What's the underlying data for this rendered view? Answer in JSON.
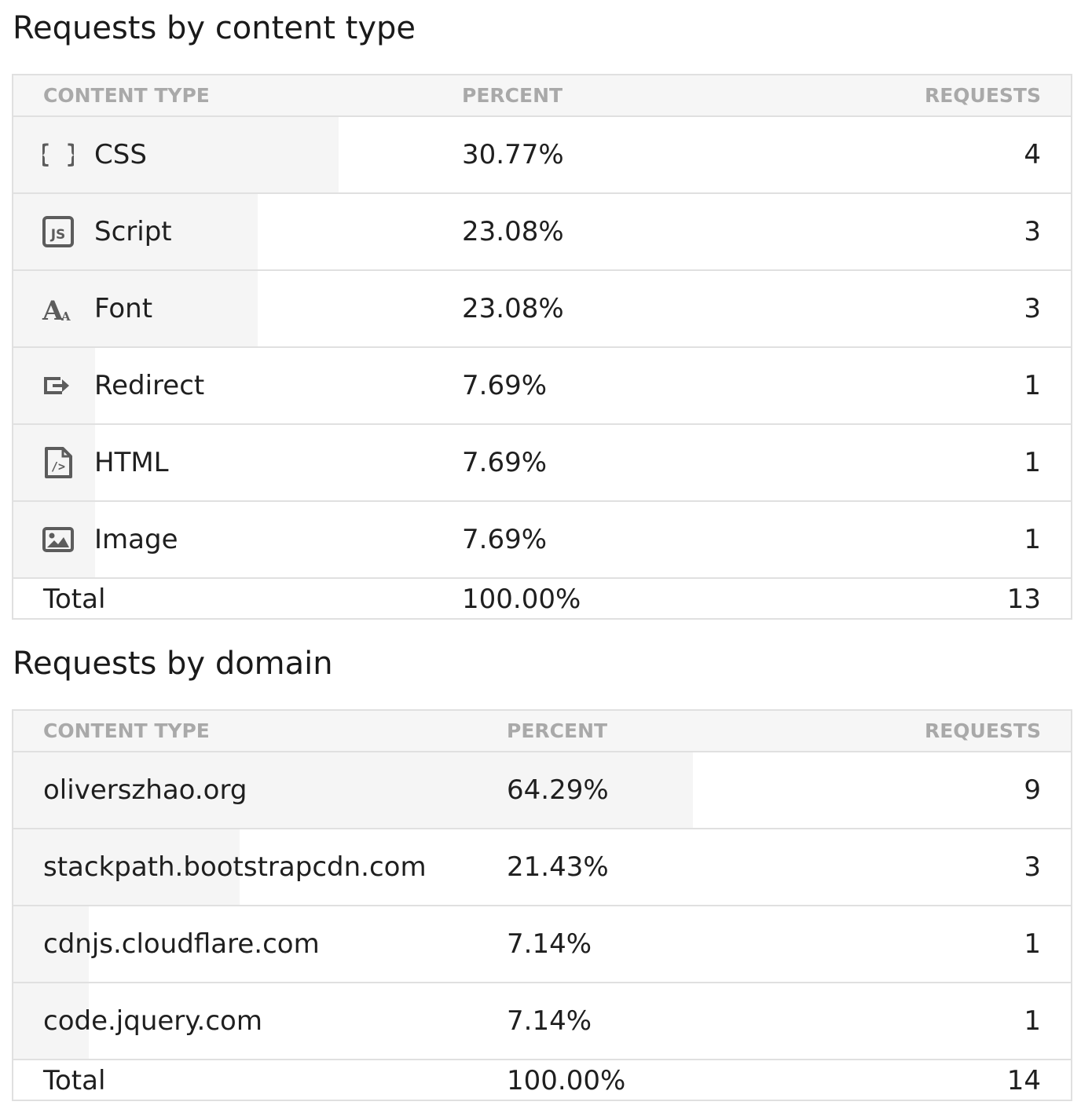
{
  "content_type_section": {
    "title": "Requests by content type",
    "headers": {
      "name": "CONTENT TYPE",
      "percent": "PERCENT",
      "requests": "REQUESTS"
    },
    "rows": [
      {
        "icon": "curly-braces-icon",
        "label": "CSS",
        "percent": "30.77%",
        "requests": "4",
        "share": 0.3077
      },
      {
        "icon": "js-file-icon",
        "label": "Script",
        "percent": "23.08%",
        "requests": "3",
        "share": 0.2308
      },
      {
        "icon": "font-icon",
        "label": "Font",
        "percent": "23.08%",
        "requests": "3",
        "share": 0.2308
      },
      {
        "icon": "redirect-arrow-icon",
        "label": "Redirect",
        "percent": "7.69%",
        "requests": "1",
        "share": 0.0769
      },
      {
        "icon": "html-file-icon",
        "label": "HTML",
        "percent": "7.69%",
        "requests": "1",
        "share": 0.0769
      },
      {
        "icon": "image-icon",
        "label": "Image",
        "percent": "7.69%",
        "requests": "1",
        "share": 0.0769
      }
    ],
    "total": {
      "label": "Total",
      "percent": "100.00%",
      "requests": "13"
    }
  },
  "domain_section": {
    "title": "Requests by domain",
    "headers": {
      "name": "CONTENT TYPE",
      "percent": "PERCENT",
      "requests": "REQUESTS"
    },
    "rows": [
      {
        "label": "oliverszhao.org",
        "percent": "64.29%",
        "requests": "9",
        "share": 0.6429
      },
      {
        "label": "stackpath.bootstrapcdn.com",
        "percent": "21.43%",
        "requests": "3",
        "share": 0.2143
      },
      {
        "label": "cdnjs.cloudflare.com",
        "percent": "7.14%",
        "requests": "1",
        "share": 0.0714
      },
      {
        "label": "code.jquery.com",
        "percent": "7.14%",
        "requests": "1",
        "share": 0.0714
      }
    ],
    "total": {
      "label": "Total",
      "percent": "100.00%",
      "requests": "14"
    }
  },
  "colors": {
    "bar_fill": "#f5f5f5",
    "header_bg": "#f6f6f6",
    "border": "#e0e0e0",
    "header_text": "#a9a9a9",
    "icon": "#5c5c5c"
  }
}
